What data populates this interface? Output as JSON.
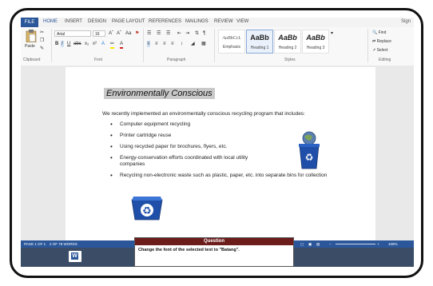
{
  "tabs": [
    "FILE",
    "HOME",
    "INSERT",
    "DESIGN",
    "PAGE LAYOUT",
    "REFERENCES",
    "MAILINGS",
    "REVIEW",
    "VIEW"
  ],
  "signin": "Sign",
  "ribbon": {
    "paste_label": "Paste",
    "font_name": "Arial",
    "font_size": "16",
    "groups": {
      "clipboard": "Clipboard",
      "font": "Font",
      "paragraph": "Paragraph",
      "styles": "Styles",
      "editing": "Editing"
    },
    "styles": [
      {
        "sample": "AaBbCcL",
        "name": "Emphasis"
      },
      {
        "sample": "AaBb",
        "name": "Heading 1"
      },
      {
        "sample": "AaBb",
        "name": "Heading 2"
      },
      {
        "sample": "AaBb",
        "name": "Heading 3"
      }
    ],
    "editing": {
      "find": "Find",
      "replace": "Replace",
      "select": "Select"
    }
  },
  "document": {
    "title": "Environmentally Conscious",
    "intro": "We recently implemented an environmentally conscious recycling program that includes:",
    "bullets": [
      "Computer equipment recycling",
      "Printer cartridge reuse",
      "Using recycled paper for brochures, flyers, etc.",
      "Energy-conservation efforts coordinated with local utility companies",
      "Recycling non-electronic waste such as plastic, paper, etc. into separate bins for collection"
    ]
  },
  "status": {
    "page": "PAGE 1 OF 1",
    "words": "2 OF 78 WORDS",
    "zoom": "100%"
  },
  "question": {
    "header": "Question",
    "text": "Change the font of the selected text to \"Batang\"."
  },
  "colors": {
    "accent": "#2b579a",
    "question_header": "#6d1c1c",
    "taskbar": "#3a4c66"
  }
}
